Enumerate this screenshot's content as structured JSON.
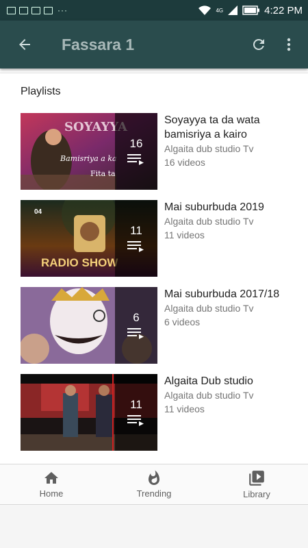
{
  "status_bar": {
    "time": "4:22 PM",
    "signal_label": "4G"
  },
  "app_bar": {
    "title": "Fassara 1",
    "back_icon": "arrow-back-icon",
    "refresh_icon": "refresh-icon",
    "menu_icon": "more-vert-icon"
  },
  "section_title": "Playlists",
  "playlists": [
    {
      "title": "Soyayya ta da wata bamisriya a kairo",
      "channel": "Algaita dub studio Tv",
      "videos": "16 videos",
      "count": "16",
      "thumb_text": "SOYAYYA",
      "thumb_sub": "Bamisriya a ka",
      "thumb_sub2": "Fita ta"
    },
    {
      "title": "Mai suburbuda 2019",
      "channel": "Algaita dub studio Tv",
      "videos": "11 videos",
      "count": "11",
      "thumb_text": "RADIO SHOW",
      "thumb_badge": "04"
    },
    {
      "title": "Mai suburbuda 2017/18",
      "channel": "Algaita dub studio Tv",
      "videos": "6 videos",
      "count": "6"
    },
    {
      "title": "Algaita Dub studio",
      "channel": "Algaita dub studio Tv",
      "videos": "11 videos",
      "count": "11"
    }
  ],
  "bottom_nav": [
    {
      "label": "Home",
      "icon": "home-icon"
    },
    {
      "label": "Trending",
      "icon": "flame-icon"
    },
    {
      "label": "Library",
      "icon": "library-icon"
    }
  ],
  "colors": {
    "status_bar": "#1d3b3c",
    "app_bar": "#2a4c4d",
    "title_text": "#a8b8b8"
  }
}
